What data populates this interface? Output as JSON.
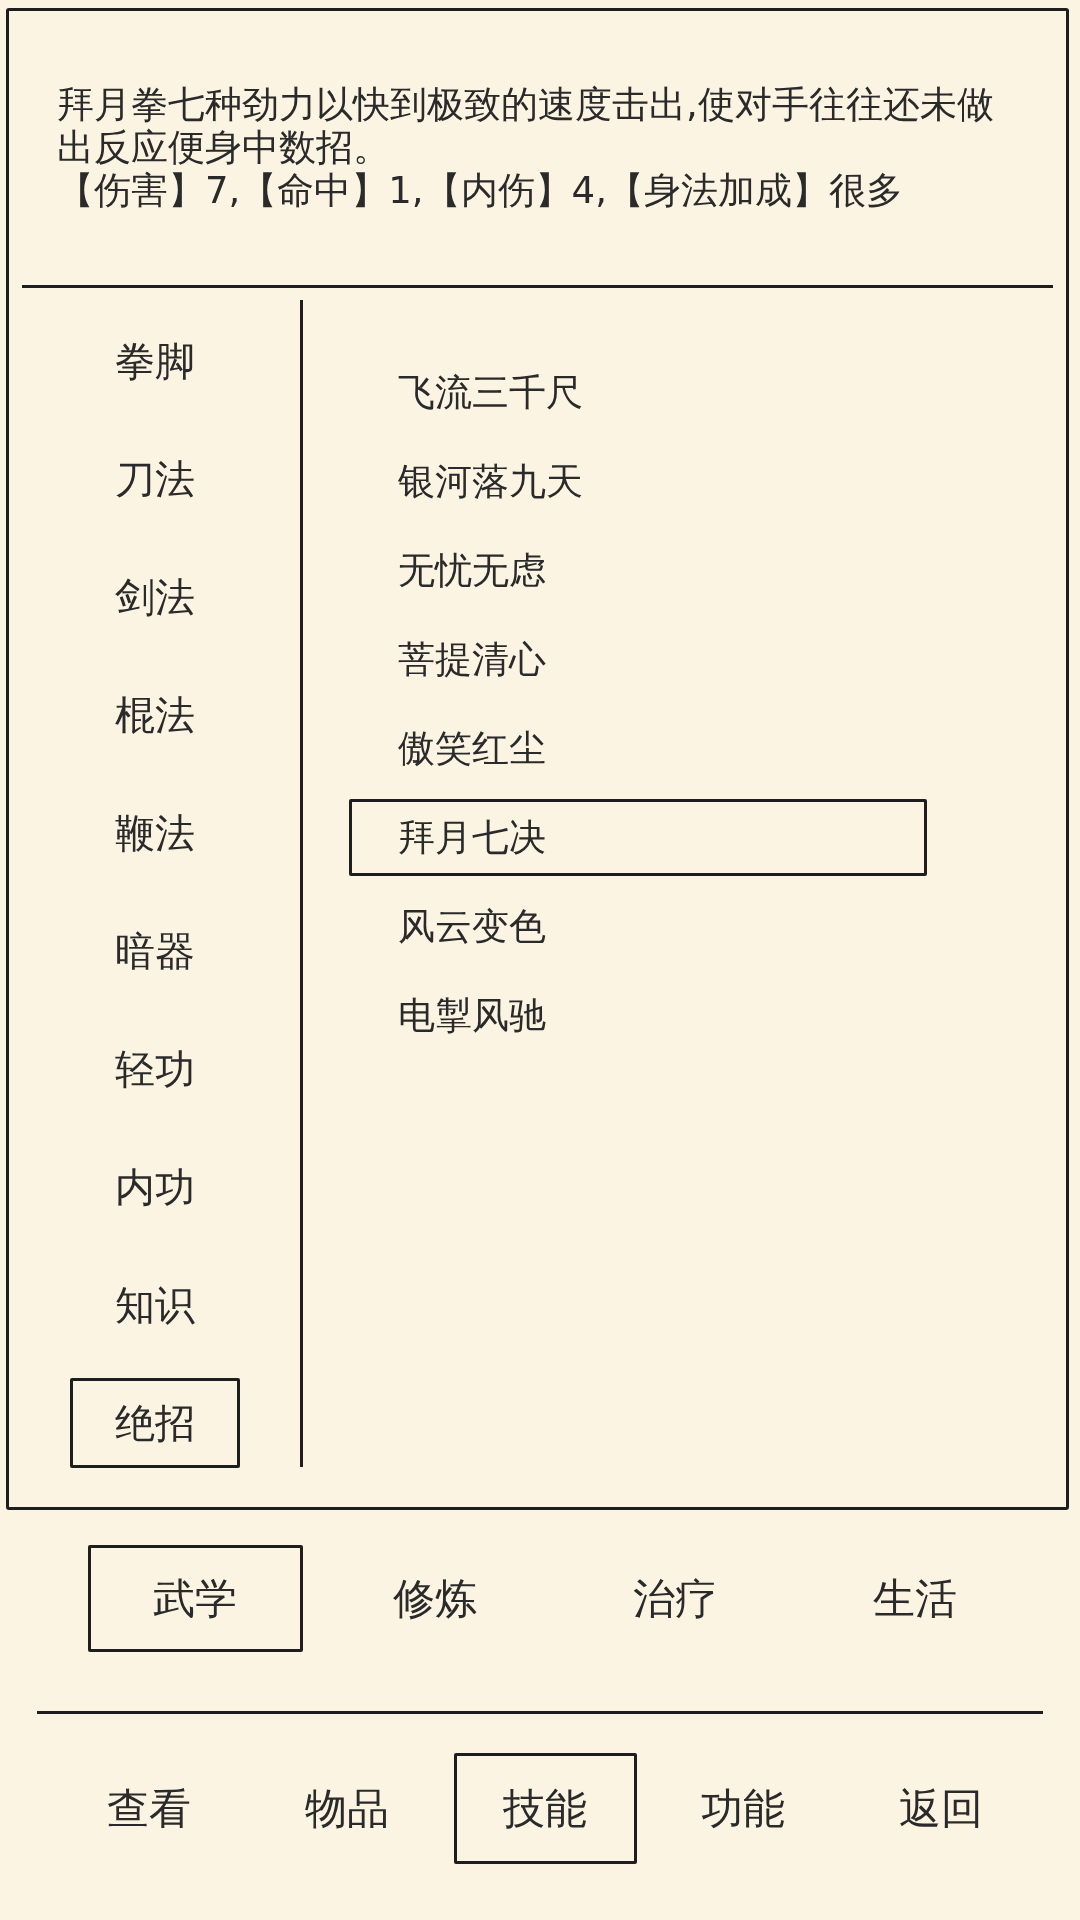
{
  "detail": {
    "description": "拜月拳七种劲力以快到极致的速度击出,使对手往往还未做出反应便身中数招。",
    "stats": "【伤害】7,【命中】1,【内伤】4,【身法加成】很多"
  },
  "categories": [
    {
      "label": "拳脚",
      "selected": false
    },
    {
      "label": "刀法",
      "selected": false
    },
    {
      "label": "剑法",
      "selected": false
    },
    {
      "label": "棍法",
      "selected": false
    },
    {
      "label": "鞭法",
      "selected": false
    },
    {
      "label": "暗器",
      "selected": false
    },
    {
      "label": "轻功",
      "selected": false
    },
    {
      "label": "内功",
      "selected": false
    },
    {
      "label": "知识",
      "selected": false
    },
    {
      "label": "绝招",
      "selected": true
    }
  ],
  "skills": [
    {
      "label": "飞流三千尺",
      "selected": false
    },
    {
      "label": "银河落九天",
      "selected": false
    },
    {
      "label": "无忧无虑",
      "selected": false
    },
    {
      "label": "菩提清心",
      "selected": false
    },
    {
      "label": "傲笑红尘",
      "selected": false
    },
    {
      "label": "拜月七决",
      "selected": true
    },
    {
      "label": "风云变色",
      "selected": false
    },
    {
      "label": "电掣风驰",
      "selected": false
    }
  ],
  "sub_tabs": [
    {
      "label": "武学",
      "selected": true
    },
    {
      "label": "修炼",
      "selected": false
    },
    {
      "label": "治疗",
      "selected": false
    },
    {
      "label": "生活",
      "selected": false
    }
  ],
  "nav": [
    {
      "label": "查看",
      "selected": false
    },
    {
      "label": "物品",
      "selected": false
    },
    {
      "label": "技能",
      "selected": true
    },
    {
      "label": "功能",
      "selected": false
    },
    {
      "label": "返回",
      "selected": false
    }
  ]
}
